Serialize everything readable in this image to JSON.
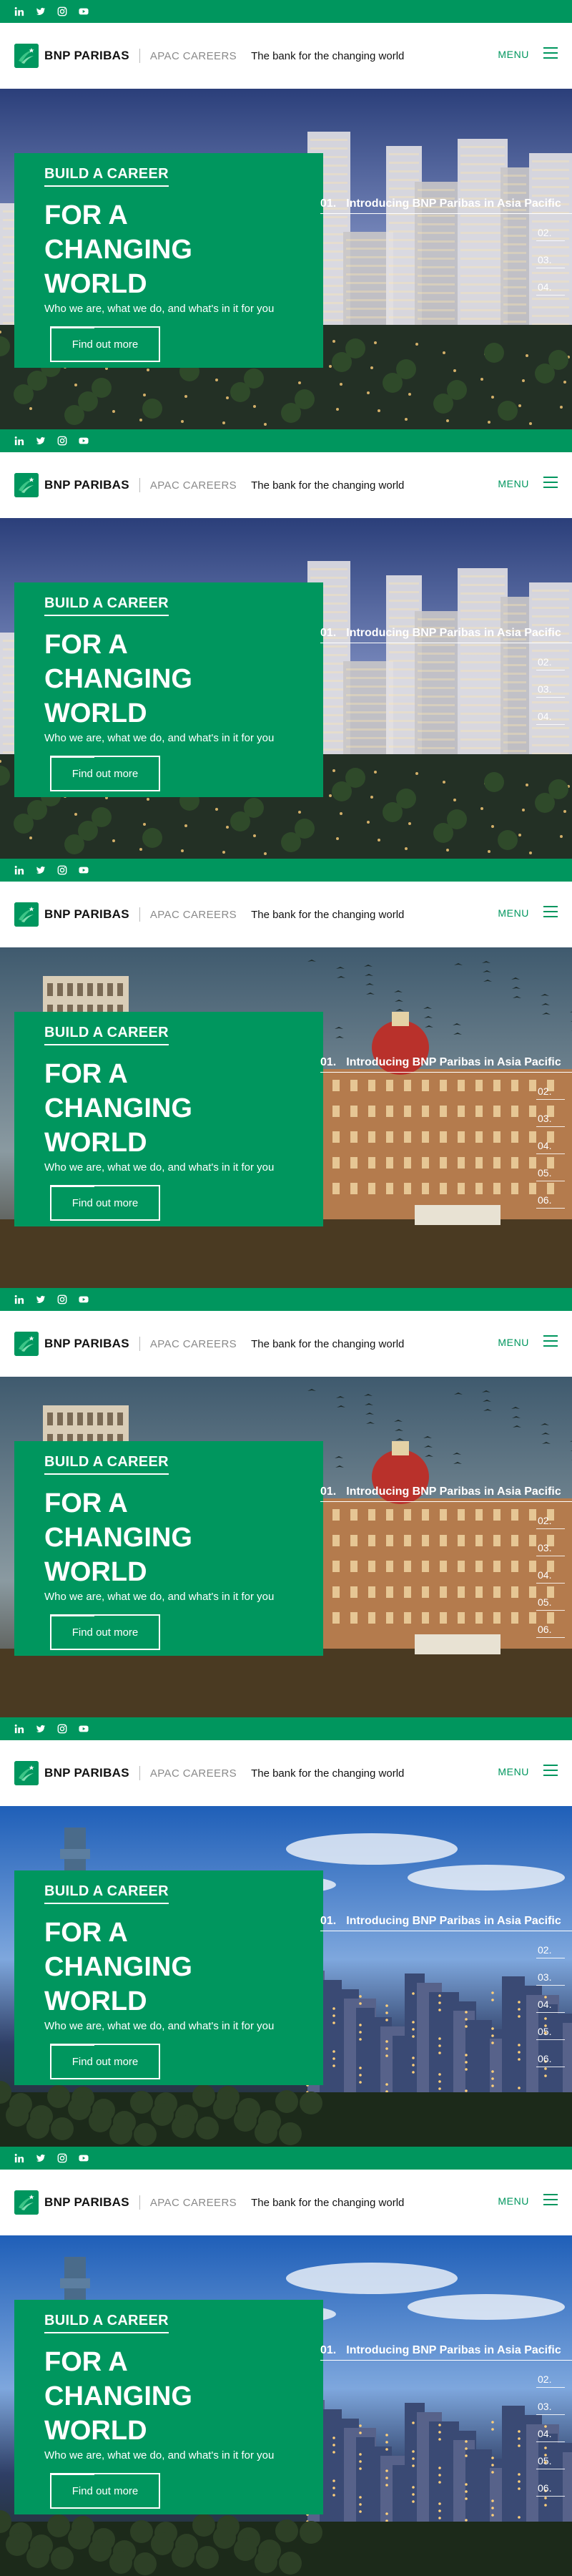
{
  "social": {
    "icons": [
      "linkedin-icon",
      "twitter-icon",
      "instagram-icon",
      "youtube-icon"
    ]
  },
  "header": {
    "brand": "BNP PARIBAS",
    "section": "APAC CAREERS",
    "tagline": "The bank for the changing world",
    "menu_label": "MENU"
  },
  "hero": {
    "eyebrow": "BUILD A CAREER",
    "headline": "FOR A CHANGING WORLD",
    "subline": "Who we are, what we do, and what's in it for you",
    "cta_label": "Find out more"
  },
  "slides": {
    "active_number": "01.",
    "active_title": "Introducing BNP Paribas in Asia Pacific",
    "items": [
      "02.",
      "03.",
      "04.",
      "05.",
      "06."
    ]
  },
  "colors": {
    "brand_green": "#00965e",
    "white": "#ffffff"
  },
  "frames": [
    {
      "scene": "city-dusk",
      "visible_slides": 3
    },
    {
      "scene": "city-dusk",
      "visible_slides": 3
    },
    {
      "scene": "palace",
      "visible_slides": 5
    },
    {
      "scene": "palace",
      "visible_slides": 5
    },
    {
      "scene": "taipei",
      "visible_slides": 5
    },
    {
      "scene": "taipei",
      "visible_slides": 5
    }
  ]
}
